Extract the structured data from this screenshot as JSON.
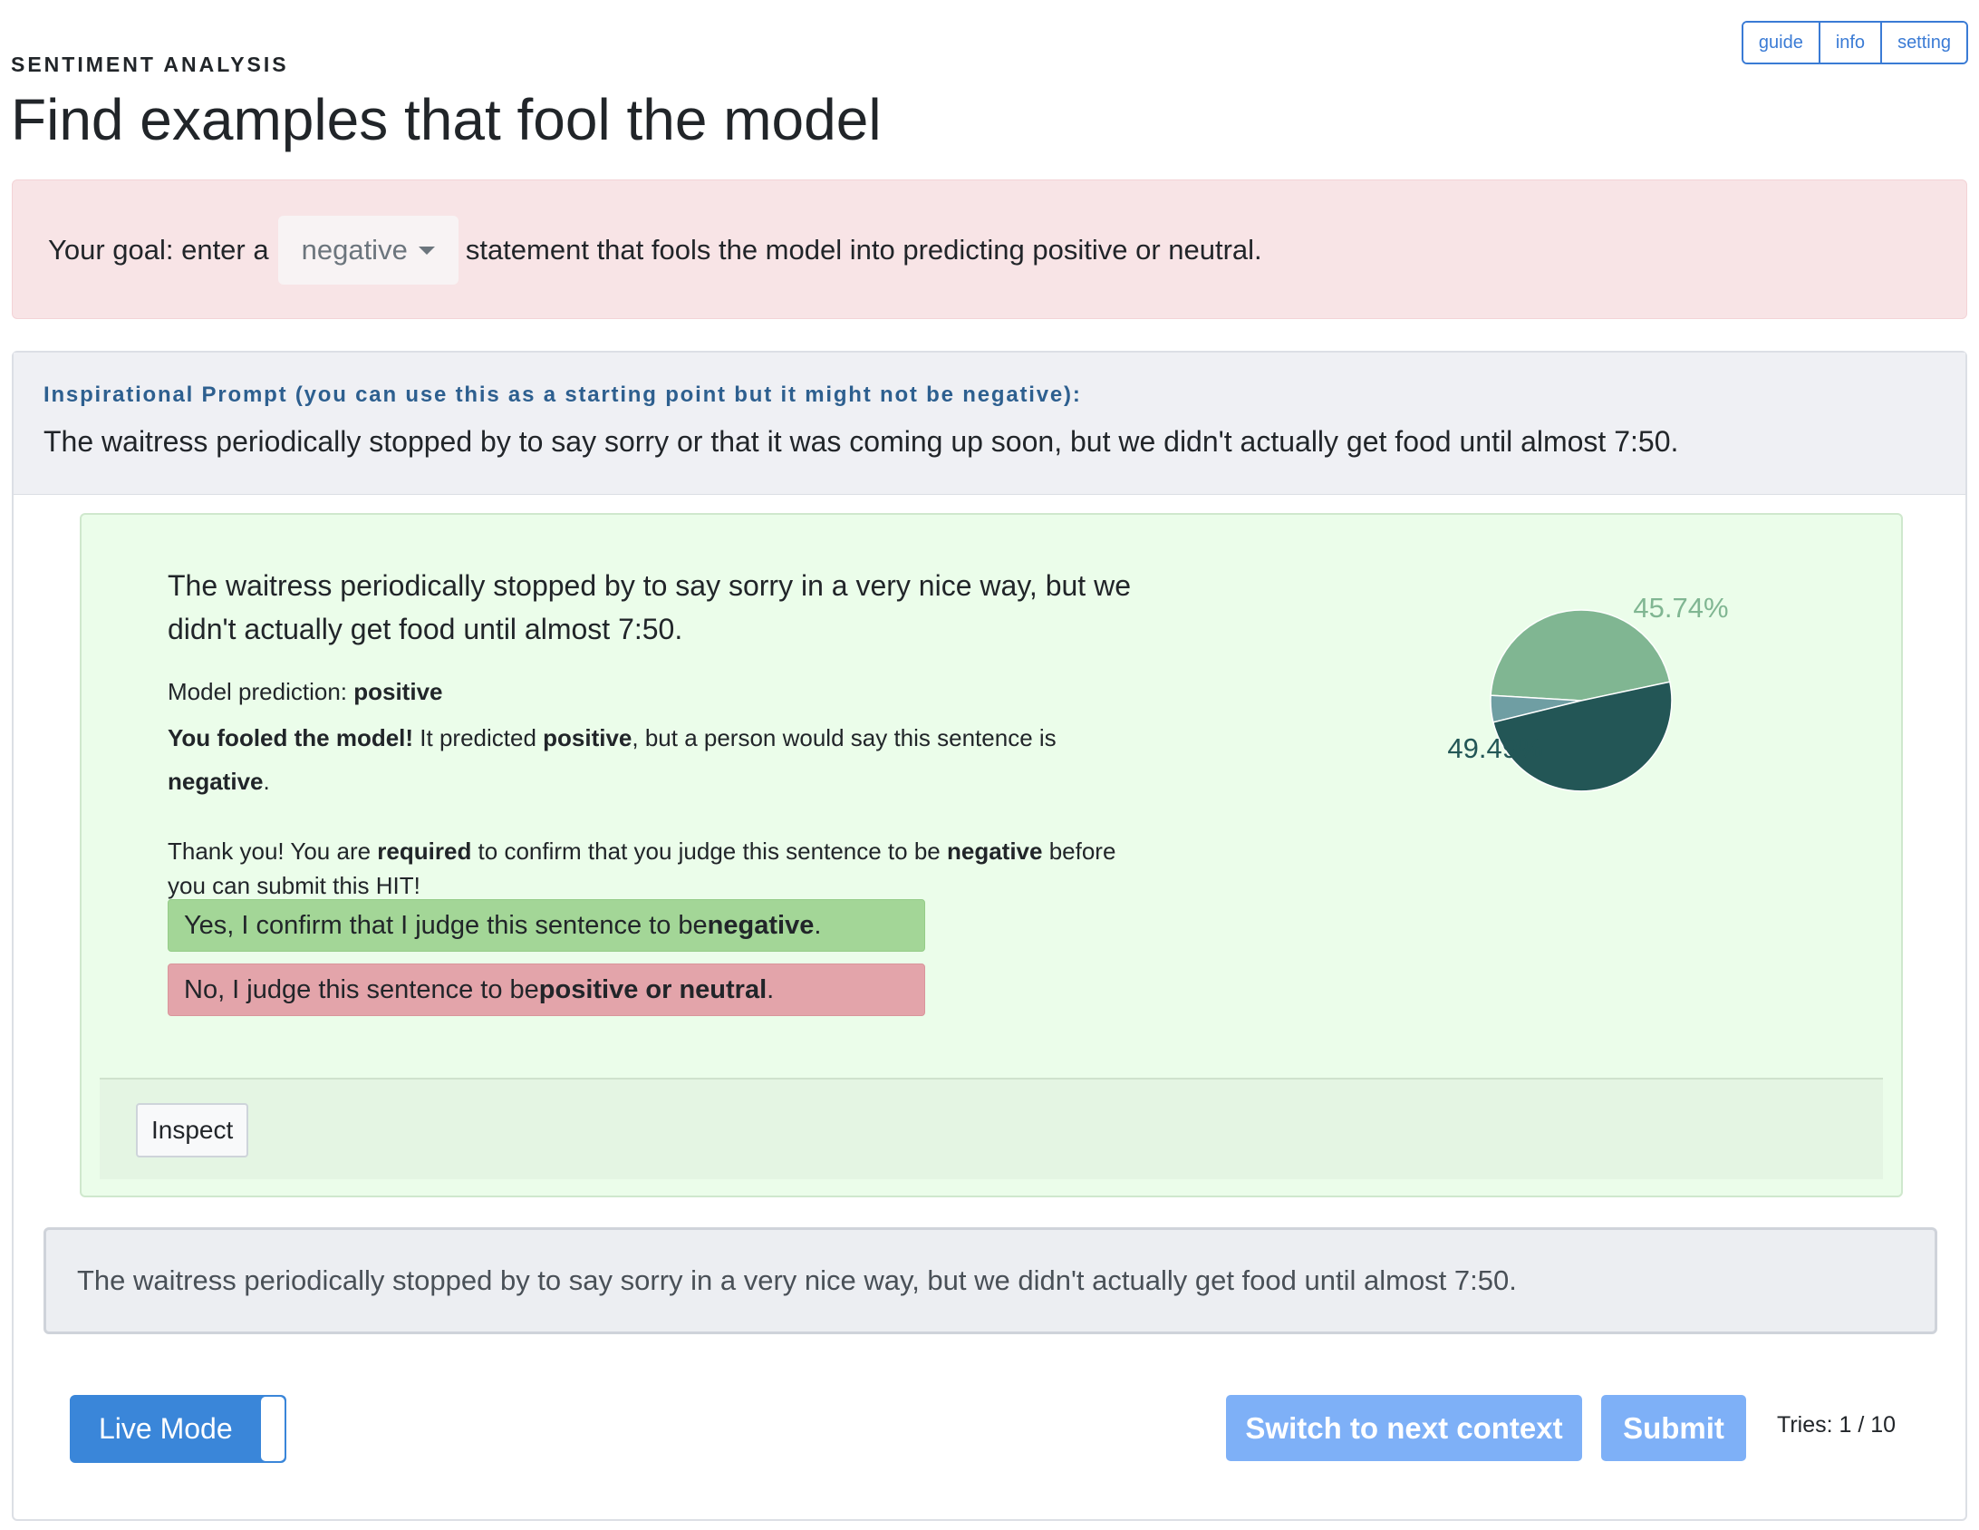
{
  "nav": {
    "items": [
      "guide",
      "info",
      "setting"
    ]
  },
  "header": {
    "task_label": "SENTIMENT ANALYSIS",
    "title": "Find examples that fool the model"
  },
  "goal": {
    "prefix": "Your goal: enter a",
    "selected": "negative",
    "suffix": "statement that fools the model into predicting positive or neutral."
  },
  "prompt": {
    "label": "Inspirational Prompt (you can use this as a starting point but it might not be negative):",
    "text": "The waitress periodically stopped by to say sorry or that it was coming up soon, but we didn't actually get food until almost 7:50."
  },
  "result": {
    "sentence": "The waitress periodically stopped by to say sorry in a very nice way, but we didn't actually get food until almost 7:50.",
    "prediction_prefix": "Model prediction: ",
    "prediction": "positive",
    "fooled_bold": "You fooled the model!",
    "fooled_mid1": " It predicted ",
    "fooled_pred": "positive",
    "fooled_mid2": ", but a person would say this sentence is ",
    "fooled_label": "negative",
    "fooled_end": ".",
    "thanks_1": "Thank you! You are ",
    "thanks_required": "required",
    "thanks_2": " to confirm that you judge this sentence to be ",
    "thanks_label": "negative",
    "thanks_3": " before you can submit this HIT!",
    "yes_prefix": "Yes, I confirm that I judge this sentence to be ",
    "yes_label": "negative",
    "yes_end": ".",
    "no_prefix": "No, I judge this sentence to be ",
    "no_label": "positive or neutral",
    "no_end": ".",
    "inspect_label": "Inspect"
  },
  "chart_data": {
    "type": "pie",
    "slices": [
      {
        "value": 45.74,
        "label": "45.74%",
        "color": "#80b692"
      },
      {
        "value": 4.77,
        "label": "",
        "color": "#6f9ea3"
      },
      {
        "value": 49.49,
        "label": "49.49%",
        "color": "#235656"
      }
    ]
  },
  "input": {
    "value": "The waitress periodically stopped by to say sorry in a very nice way, but we didn't actually get food until almost 7:50."
  },
  "footer": {
    "live_mode_label": "Live Mode",
    "next_context_label": "Switch to next context",
    "submit_label": "Submit",
    "tries": "Tries: 1 / 10"
  }
}
